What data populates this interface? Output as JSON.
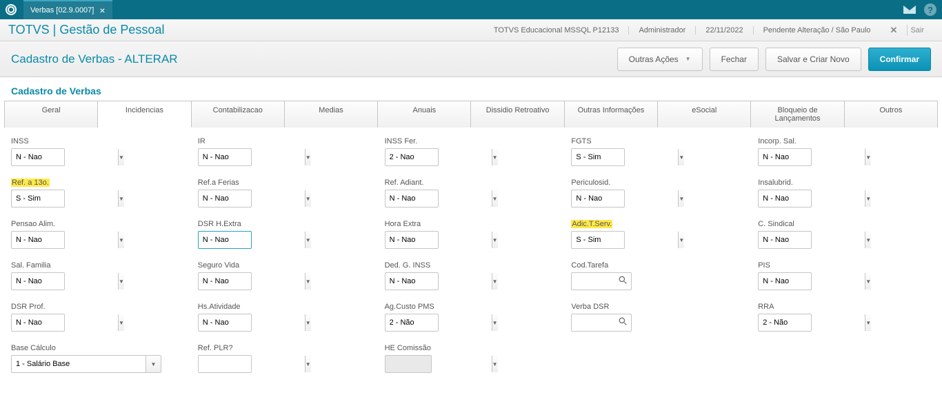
{
  "titleBar": {
    "tab": "Verbas [02.9.0007]"
  },
  "header": {
    "appTitle": "TOTVS | Gestão de Pessoal",
    "env": "TOTVS Educacional MSSQL P12133",
    "user": "Administrador",
    "date": "22/11/2022",
    "status": "Pendente Alteração / São Paulo",
    "exit": "Sair"
  },
  "actionBar": {
    "breadcrumb": "Cadastro de Verbas - ALTERAR",
    "buttons": {
      "outras": "Outras Ações",
      "fechar": "Fechar",
      "salvar": "Salvar e Criar Novo",
      "confirmar": "Confirmar"
    }
  },
  "sectionTitle": "Cadastro de Verbas",
  "tabs": [
    "Geral",
    "Incidencias",
    "Contabilizacao",
    "Medias",
    "Anuais",
    "Dissidio Retroativo",
    "Outras Informações",
    "eSocial",
    "Bloqueio de Lançamentos",
    "Outros"
  ],
  "activeTab": "Incidencias",
  "fields": {
    "inss": {
      "label": "INSS",
      "value": "N - Nao"
    },
    "ir": {
      "label": "IR",
      "value": "N - Nao"
    },
    "inssFer": {
      "label": "INSS Fer.",
      "value": "2 - Nao"
    },
    "fgts": {
      "label": "FGTS",
      "value": "S - Sim"
    },
    "incorpSal": {
      "label": "Incorp. Sal.",
      "value": "N - Nao"
    },
    "ref13": {
      "label": "Ref. a 13o.",
      "value": "S - Sim"
    },
    "refFerias": {
      "label": "Ref.a Ferias",
      "value": "N - Nao"
    },
    "refAdiant": {
      "label": "Ref. Adiant.",
      "value": "N - Nao"
    },
    "periculosid": {
      "label": "Periculosid.",
      "value": "N - Nao"
    },
    "insalubrid": {
      "label": "Insalubrid.",
      "value": "N - Nao"
    },
    "pensaoAlim": {
      "label": "Pensao Alim.",
      "value": "N - Nao"
    },
    "dsrHExtra": {
      "label": "DSR H.Extra",
      "value": "N - Nao"
    },
    "horaExtra": {
      "label": "Hora Extra",
      "value": "N - Nao"
    },
    "adicTServ": {
      "label": "Adic.T.Serv.",
      "value": "S - Sim"
    },
    "cSindical": {
      "label": "C. Sindical",
      "value": "N - Nao"
    },
    "salFamilia": {
      "label": "Sal. Familia",
      "value": "N - Nao"
    },
    "seguroVida": {
      "label": "Seguro Vida",
      "value": "N - Nao"
    },
    "dedGInss": {
      "label": "Ded. G. INSS",
      "value": "N - Nao"
    },
    "codTarefa": {
      "label": "Cod.Tarefa",
      "value": ""
    },
    "pis": {
      "label": "PIS",
      "value": "N - Nao"
    },
    "dsrProf": {
      "label": "DSR Prof.",
      "value": "N - Nao"
    },
    "hsAtividade": {
      "label": "Hs.Atividade",
      "value": "N - Nao"
    },
    "agCustoPms": {
      "label": "Ag.Custo PMS",
      "value": "2 - Não"
    },
    "verbaDsr": {
      "label": "Verba DSR",
      "value": ""
    },
    "rra": {
      "label": "RRA",
      "value": "2 - Não"
    },
    "baseCalculo": {
      "label": "Base Cálculo",
      "value": "1 - Salário Base"
    },
    "refPlr": {
      "label": "Ref. PLR?",
      "value": ""
    },
    "heComissao": {
      "label": "HE Comissão",
      "value": ""
    }
  }
}
